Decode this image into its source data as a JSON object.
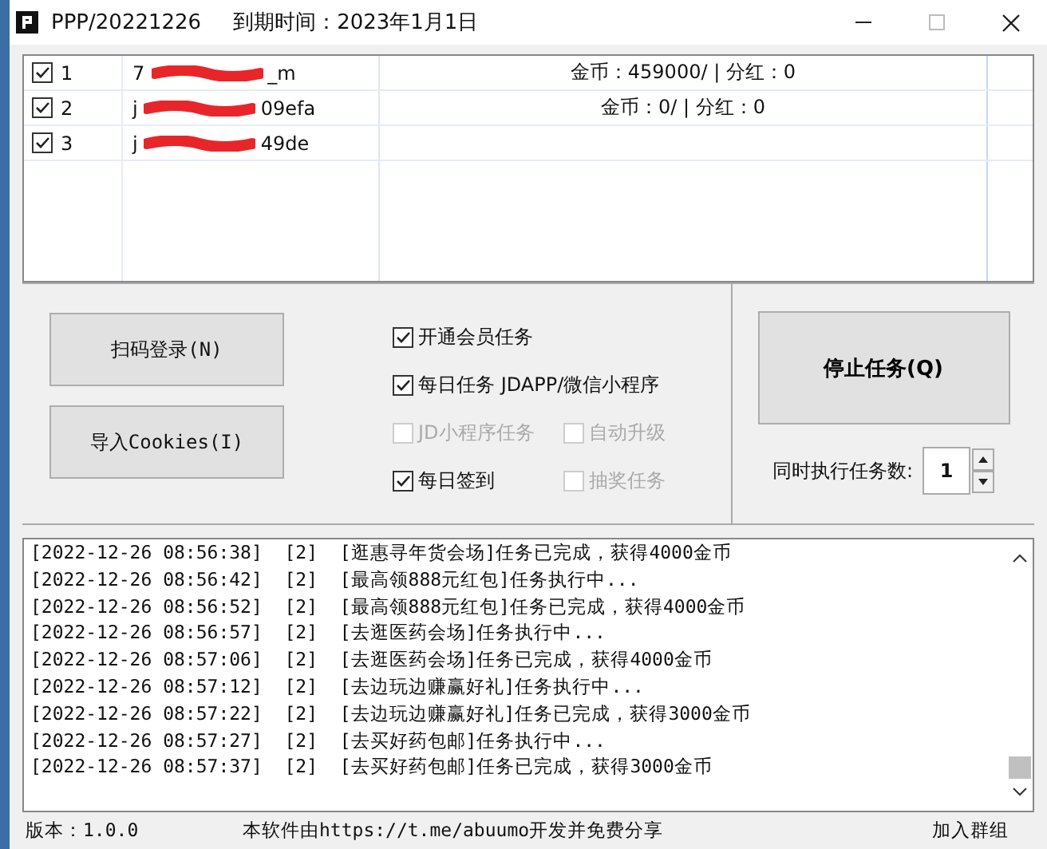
{
  "window": {
    "title": "PPP/20221226",
    "expiry": "到期时间：2023年1月1日"
  },
  "accounts": [
    {
      "index": "1",
      "checked": true,
      "name_start": "7",
      "name_end": "_m",
      "coins": "金币：459000/ | 分红：0"
    },
    {
      "index": "2",
      "checked": true,
      "name_start": "j",
      "name_end": "09efa",
      "coins": "金币：0/ | 分红：0"
    },
    {
      "index": "3",
      "checked": true,
      "name_start": "j",
      "name_end": "49de"
    }
  ],
  "buttons": [
    {
      "label": "扫码登录(N)"
    },
    {
      "label": "导入Cookies(I)"
    }
  ],
  "options": [
    [
      {
        "label": "开通会员任务",
        "checked": true,
        "disabled": false
      }
    ],
    [
      {
        "label": "每日任务 JDAPP/微信小程序",
        "checked": true,
        "disabled": false
      }
    ],
    [
      {
        "label": "JD小程序任务",
        "checked": false,
        "disabled": true
      },
      {
        "label": "自动升级",
        "checked": false,
        "disabled": true
      }
    ],
    [
      {
        "label": "每日签到",
        "checked": true,
        "disabled": false
      },
      {
        "label": "抽奖任务",
        "checked": false,
        "disabled": true
      }
    ]
  ],
  "stop_button": "停止任务(Q)",
  "concurrency": {
    "label": "同时执行任务数:",
    "value": "1"
  },
  "log": [
    "[2022-12-26 08:56:38]  [2]  [逛惠寻年货会场]任务已完成，获得4000金币",
    "[2022-12-26 08:56:42]  [2]  [最高领888元红包]任务执行中...",
    "[2022-12-26 08:56:52]  [2]  [最高领888元红包]任务已完成，获得4000金币",
    "[2022-12-26 08:56:57]  [2]  [去逛医药会场]任务执行中...",
    "[2022-12-26 08:57:06]  [2]  [去逛医药会场]任务已完成，获得4000金币",
    "[2022-12-26 08:57:12]  [2]  [去边玩边赚赢好礼]任务执行中...",
    "[2022-12-26 08:57:22]  [2]  [去边玩边赚赢好礼]任务已完成，获得3000金币",
    "[2022-12-26 08:57:27]  [2]  [去买好药包邮]任务执行中...",
    "[2022-12-26 08:57:37]  [2]  [去买好药包邮]任务已完成，获得3000金币"
  ],
  "status_bar": {
    "version": "版本：1.0.0",
    "credit": "本软件由https://t.me/abuumo开发并免费分享",
    "link": "加入群组"
  }
}
